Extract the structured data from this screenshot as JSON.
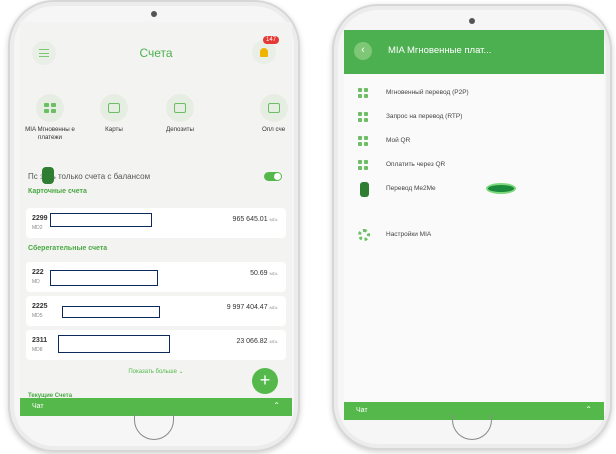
{
  "left": {
    "header": {
      "title": "Счета",
      "badge": "147"
    },
    "tiles": [
      {
        "label": "MIA Мгновенны е платежи",
        "icon": "dots-icon"
      },
      {
        "label": "Карты",
        "icon": "cards-icon"
      },
      {
        "label": "Депозиты",
        "icon": "deposit-icon"
      },
      {
        "label": "Опл сче",
        "icon": "payment-icon"
      }
    ],
    "filter": {
      "label": "Пс  зать только счета с балансом",
      "toggle_on": true
    },
    "card_section": {
      "title": "Карточные счета"
    },
    "card_accounts": [
      {
        "number": "2299",
        "sub": "MD2",
        "amount": "965 645.01",
        "currency": "MDL"
      }
    ],
    "savings_section": {
      "title": "Сберегательные счета"
    },
    "savings_accounts": [
      {
        "number": "222",
        "sub": "MD",
        "amount": "50.69",
        "currency": "MDL"
      },
      {
        "number": "2225",
        "sub": "MD5",
        "amount": "9 997 404.47",
        "currency": "MDL"
      },
      {
        "number": "2311",
        "sub": "MD8",
        "amount": "23 066.82",
        "currency": "MDL"
      }
    ],
    "show_more": "Показать больше  ⌄",
    "fab": "+",
    "next_section_peek": "Текущие Счета",
    "chat": {
      "label": "Чат",
      "chevron": "⌃"
    },
    "colors": {
      "brand_green": "#54b94a",
      "mask_border": "#0c2a5c"
    }
  },
  "right": {
    "header": {
      "title": "MIA Мгновенные плат...",
      "back": "‹"
    },
    "items": [
      {
        "label": "Мгновенный перевод (P2P)",
        "icon": "grid-icon"
      },
      {
        "label": "Запрос на перевод (RTP)",
        "icon": "grid-icon"
      },
      {
        "label": "Мой QR",
        "icon": "qr-icon"
      },
      {
        "label": "Оплатить через QR",
        "icon": "qr-icon"
      },
      {
        "label": "Перевод Me2Me",
        "icon": "pin-icon"
      },
      {
        "label": "Настройки MIA",
        "icon": "gear-icon"
      }
    ],
    "chat": {
      "label": "Чат",
      "chevron": "⌃"
    }
  }
}
